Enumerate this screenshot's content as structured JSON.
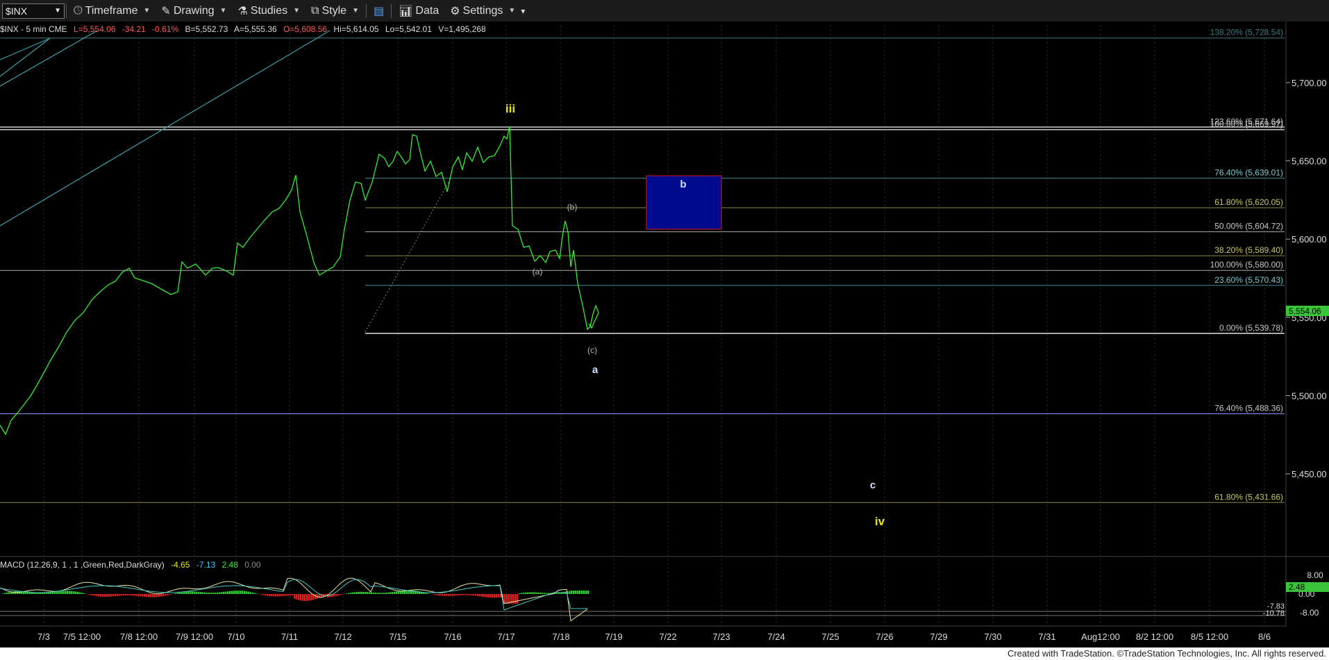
{
  "toolbar": {
    "symbol": "$INX",
    "timeframe": "Timeframe",
    "drawing": "Drawing",
    "studies": "Studies",
    "style": "Style",
    "data": "Data",
    "settings": "Settings"
  },
  "quote": {
    "prefix": "$INX - 5 min  CME",
    "last": "L=5,554.06",
    "change": "-34.21",
    "pct": "-0.61%",
    "bid": "B=5,552.73",
    "ask": "A=5,555.36",
    "open": "O=5,608.56",
    "high": "Hi=5,614.05",
    "low": "Lo=5,542.01",
    "volume": "V=1,495,268"
  },
  "colors": {
    "price": "#33ee33",
    "fib_label": "#b9b9b9",
    "yellow_label": "#e8e800",
    "wave_label": "#cfe2ff",
    "box_fill": "#000a8c",
    "box_border": "#d11c1c",
    "last_price_bg": "#3ac43a"
  },
  "price_axis": {
    "ticks": [
      "5,700.00",
      "5,650.00",
      "5,600.00",
      "5,550.00",
      "5,500.00",
      "5,450.00"
    ],
    "last_price": "5,554.06"
  },
  "time_axis": [
    "7/3",
    "7/5 12:00",
    "7/8 12:00",
    "7/9 12:00",
    "7/10",
    "7/11",
    "7/12",
    "7/15",
    "7/16",
    "7/17",
    "7/18",
    "7/19",
    "7/22",
    "7/23",
    "7/24",
    "7/25",
    "7/26",
    "7/29",
    "7/30",
    "7/31",
    "Aug12:00",
    "8/2 12:00",
    "8/5 12:00",
    "8/6"
  ],
  "fib_levels": [
    {
      "label": "138.20% (5,728.54)",
      "price": 5728.54
    },
    {
      "label": "123.60% (5,671.64)",
      "price": 5671.64
    },
    {
      "label": "100.00% (5,669.97)",
      "price": 5669.97
    },
    {
      "label": "76.40% (5,639.01)",
      "price": 5639.01
    },
    {
      "label": "61.80% (5,620.05)",
      "price": 5620.05
    },
    {
      "label": "50.00% (5,604.72)",
      "price": 5604.72
    },
    {
      "label": "38.20% (5,589.40)",
      "price": 5589.4
    },
    {
      "label": "100.00% (5,580.00)",
      "price": 5580.0
    },
    {
      "label": "23.60% (5,570.43)",
      "price": 5570.43
    },
    {
      "label": "0.00% (5,539.78)",
      "price": 5539.78
    },
    {
      "label": "76.40% (5,488.36)",
      "price": 5488.36
    },
    {
      "label": "61.80% (5,431.66)",
      "price": 5431.66
    }
  ],
  "wave_labels": {
    "iii": "iii",
    "b": "b",
    "b_small": "(b)",
    "a_small": "(a)",
    "c_small": "(c)",
    "a": "a",
    "c": "c",
    "iv": "iv"
  },
  "macd": {
    "title": "MACD (12,26,9, 1 , 1 ,Green,Red,DarkGray)",
    "v1": "-4.65",
    "v2": "-7.13",
    "v3": "2.48",
    "v4": "0.00",
    "ticks": [
      "8.00",
      "0.00",
      "-8.00"
    ],
    "tag_hist": "2.48",
    "tag_a": "-7.83",
    "tag_b": "-10.78"
  },
  "footer": "Created with TradeStation. ©TradeStation Technologies, Inc. All rights reserved."
}
